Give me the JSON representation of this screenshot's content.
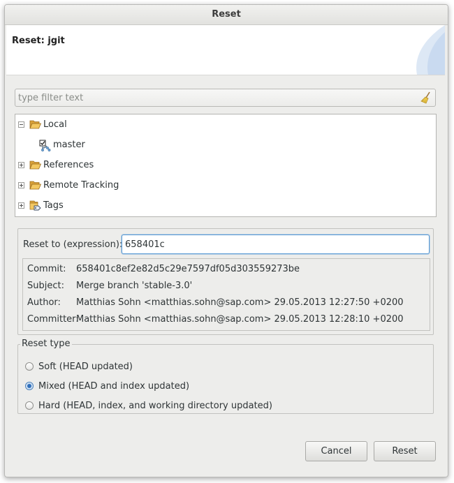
{
  "window": {
    "title": "Reset"
  },
  "banner": {
    "title": "Reset: jgit"
  },
  "filter": {
    "placeholder": "type filter text",
    "value": ""
  },
  "tree": {
    "items": [
      {
        "label": "Local",
        "expanded": true,
        "icon": "folder-open-icon"
      },
      {
        "label": "master",
        "icon": "branch-checked-out-icon"
      },
      {
        "label": "References",
        "expanded": false,
        "icon": "folder-icon"
      },
      {
        "label": "Remote Tracking",
        "expanded": false,
        "icon": "folder-icon"
      },
      {
        "label": "Tags",
        "expanded": false,
        "icon": "tags-icon"
      }
    ]
  },
  "reset_to": {
    "label": "Reset to (expression):",
    "value": "658401c"
  },
  "commit_info": {
    "rows": [
      {
        "key": "Commit:",
        "value": "658401c8ef2e82d5c29e7597df05d303559273be"
      },
      {
        "key": "Subject:",
        "value": "Merge branch 'stable-3.0'"
      },
      {
        "key": "Author:",
        "value": "Matthias Sohn <matthias.sohn@sap.com> 29.05.2013 12:27:50 +0200"
      },
      {
        "key": "Committer:",
        "value": "Matthias Sohn <matthias.sohn@sap.com> 29.05.2013 12:28:10 +0200"
      }
    ]
  },
  "reset_type": {
    "legend": "Reset type",
    "options": [
      {
        "label": "Soft (HEAD updated)",
        "checked": false
      },
      {
        "label": "Mixed (HEAD and index updated)",
        "checked": true
      },
      {
        "label": "Hard (HEAD, index, and working directory updated)",
        "checked": false
      }
    ]
  },
  "buttons": {
    "cancel": "Cancel",
    "reset": "Reset"
  },
  "colors": {
    "accent": "#2f6fba",
    "folder": "#e9b44c",
    "background": "#ededeb"
  }
}
